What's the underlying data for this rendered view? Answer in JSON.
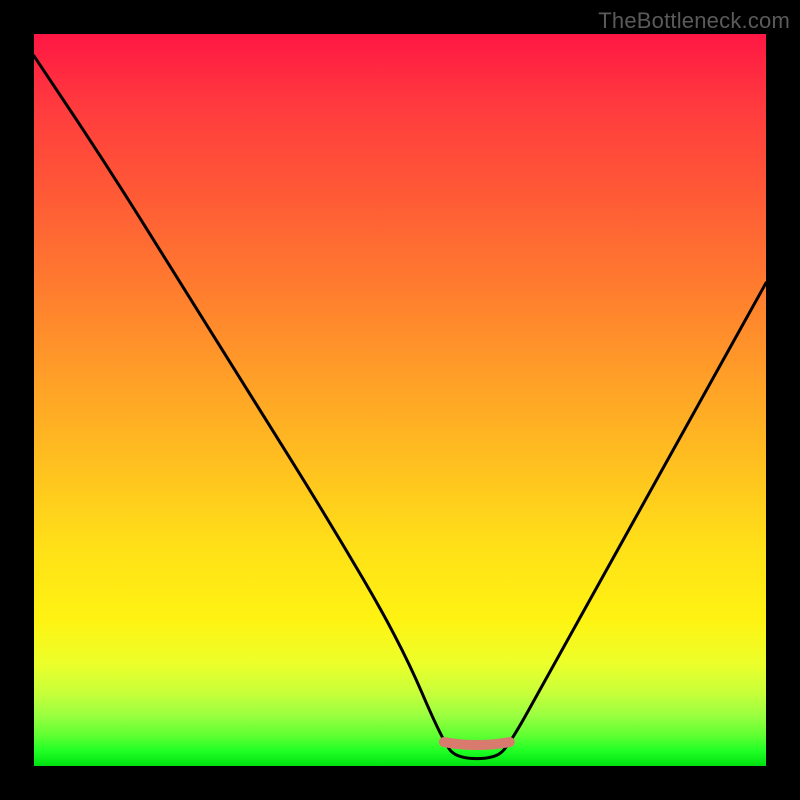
{
  "watermark": "TheBottleneck.com",
  "chart_data": {
    "type": "line",
    "title": "",
    "xlabel": "",
    "ylabel": "",
    "xlim": [
      0,
      100
    ],
    "ylim": [
      0,
      100
    ],
    "grid": false,
    "series": [
      {
        "name": "bottleneck-curve",
        "x": [
          0,
          10,
          20,
          30,
          40,
          50,
          56,
          58,
          63,
          65,
          70,
          80,
          90,
          100
        ],
        "values": [
          97,
          82,
          66,
          50,
          34,
          17,
          3,
          1,
          1,
          3,
          12,
          30,
          48,
          66
        ]
      }
    ],
    "marker": {
      "name": "optimal-range",
      "x_start": 56,
      "x_end": 65,
      "color": "#d97a6e"
    },
    "legend": false
  },
  "colors": {
    "curve": "#000000",
    "marker": "#d97a6e",
    "frame": "#000000"
  }
}
